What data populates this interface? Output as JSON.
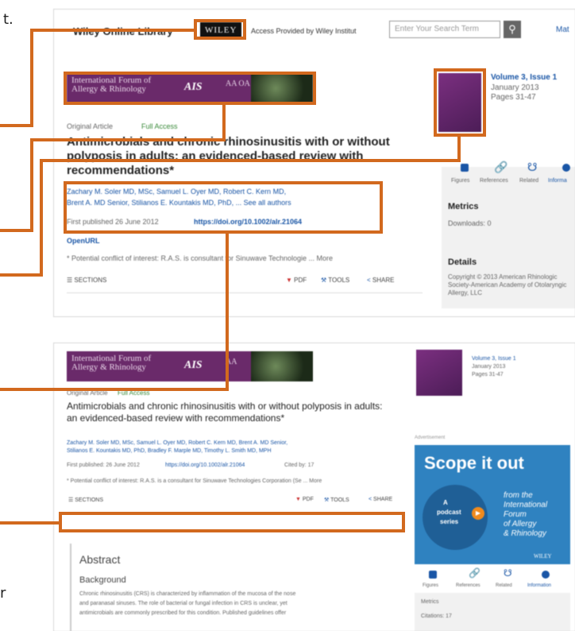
{
  "edge_text": {
    "top": "t.",
    "bottom": "r"
  },
  "shot1": {
    "header": {
      "site_title": "Wiley Online Library",
      "wiley_logo": "WILEY",
      "access_text": "Access Provided by Wiley Institut",
      "search_placeholder": "Enter Your Search Term",
      "more": "Mat"
    },
    "banner": {
      "journal": "International Forum of Allergy & Rhinology",
      "society": "AIS",
      "small": "AA OA"
    },
    "article": {
      "type": "Original Article",
      "access": "Full Access",
      "title": "Antimicrobials and chronic rhinosinusitis with or without polyposis in adults: an evidenced-based review with recommendations*",
      "authors_line1": "Zachary M. Soler MD, MSc, Samuel L. Oyer MD, Robert C. Kern MD,",
      "authors_line2": "Brent A. MD Senior, Stilianos E. Kountakis MD, PhD, ... See all authors",
      "published": "First published 26 June 2012",
      "doi": "https://doi.org/10.1002/alr.21064",
      "openurl": "OpenURL",
      "conflict": "* Potential conflict of interest: R.A.S. is consultant for Sinuwave Technologie ... More",
      "sections": "SECTIONS",
      "pdf": "PDF",
      "tools": "TOOLS",
      "share": "SHARE"
    },
    "sidebar": {
      "volume": "Volume 3, Issue 1",
      "date": "January 2013",
      "pages": "Pages 31-47",
      "tabs": [
        "Figures",
        "References",
        "Related",
        "Informa"
      ],
      "metrics_title": "Metrics",
      "downloads": "Downloads: 0",
      "details_title": "Details",
      "copyright": "Copyright © 2013 American Rhinologic Society-American Academy of Otolaryngic Allergy, LLC"
    }
  },
  "shot2": {
    "banner": {
      "journal": "International Forum of Allergy & Rhinology",
      "society": "AIS",
      "small": "AA"
    },
    "article": {
      "type": "Original Article",
      "access": "Full Access",
      "title": "Antimicrobials and chronic rhinosinusitis with or without polyposis in adults: an evidenced-based review with recommendations*",
      "authors_line1": "Zachary M. Soler MD, MSc, Samuel L. Oyer MD, Robert C. Kern MD, Brent A. MD Senior,",
      "authors_line2": "Stilianos E. Kountakis MD, PhD, Bradley F. Marple MD, Timothy L. Smith MD, MPH",
      "published": "First published: 26 June 2012",
      "doi": "https://doi.org/10.1002/alr.21064",
      "cited": "Cited by: 17",
      "conflict": "* Potential conflict of interest: R.A.S. is a consultant for Sinuwave Technologies Corporation (Se ... More",
      "sections": "SECTIONS",
      "pdf": "PDF",
      "tools": "TOOLS",
      "share": "SHARE",
      "abstract": "Abstract",
      "background": "Background",
      "bg_text1": "Chronic rhinosinusitis (CRS) is characterized by inflammation of the mucosa of the nose",
      "bg_text2": "and paranasal sinuses. The role of bacterial or fungal infection in CRS is unclear, yet",
      "bg_text3": "antimicrobials are commonly prescribed for this condition. Published guidelines offer"
    },
    "sidebar": {
      "volume": "Volume 3, Issue 1",
      "date": "January 2013",
      "pages": "Pages 31-47",
      "advertisement": "Advertisement",
      "ad_headline": "Scope it out",
      "ad_badge_a": "A",
      "ad_badge_podcast": "podcast",
      "ad_badge_series": "series",
      "ad_from": "from the",
      "ad_intl": "International",
      "ad_forum": "Forum",
      "ad_of": "of Allergy",
      "ad_rhino": "& Rhinology",
      "ad_wiley": "WILEY",
      "tabs": [
        "Figures",
        "References",
        "Related",
        "Information"
      ],
      "metrics_title": "Metrics",
      "citations": "Citations: 17"
    }
  },
  "colors": {
    "annotation": "#d2691e",
    "link": "#1a56a6",
    "banner": "#6a2a6a",
    "ad": "#2f82c0"
  }
}
